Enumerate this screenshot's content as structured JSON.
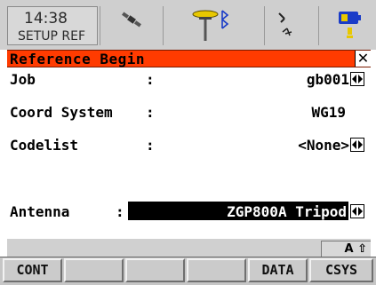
{
  "status": {
    "time": "14:38",
    "screen_id": "SETUP REF"
  },
  "dialog": {
    "title": "Reference Begin",
    "close_glyph": "✕"
  },
  "fields": {
    "job": {
      "label": "Job",
      "colon": ":",
      "value": "gb001"
    },
    "coord_system": {
      "label": "Coord System",
      "colon": ":",
      "value": "WG19"
    },
    "codelist": {
      "label": "Codelist",
      "colon": ":",
      "value": "<None>"
    },
    "antenna": {
      "label": "Antenna",
      "colon": ":",
      "value": "ZGP800A Tripod"
    }
  },
  "input_mode": "A ⇧",
  "function_keys": [
    {
      "label": "CONT"
    },
    {
      "label": ""
    },
    {
      "label": ""
    },
    {
      "label": ""
    },
    {
      "label": "DATA"
    },
    {
      "label": "CSYS"
    }
  ],
  "colors": {
    "title_bar": "#ff3b00",
    "status_bar": "#cfcfcf",
    "selection": "#000000"
  },
  "icons": {
    "satellite": "satellite-icon",
    "rover": "gps-antenna-bluetooth-icon",
    "radio": "radio-link-icon",
    "battery": "battery-icon"
  }
}
